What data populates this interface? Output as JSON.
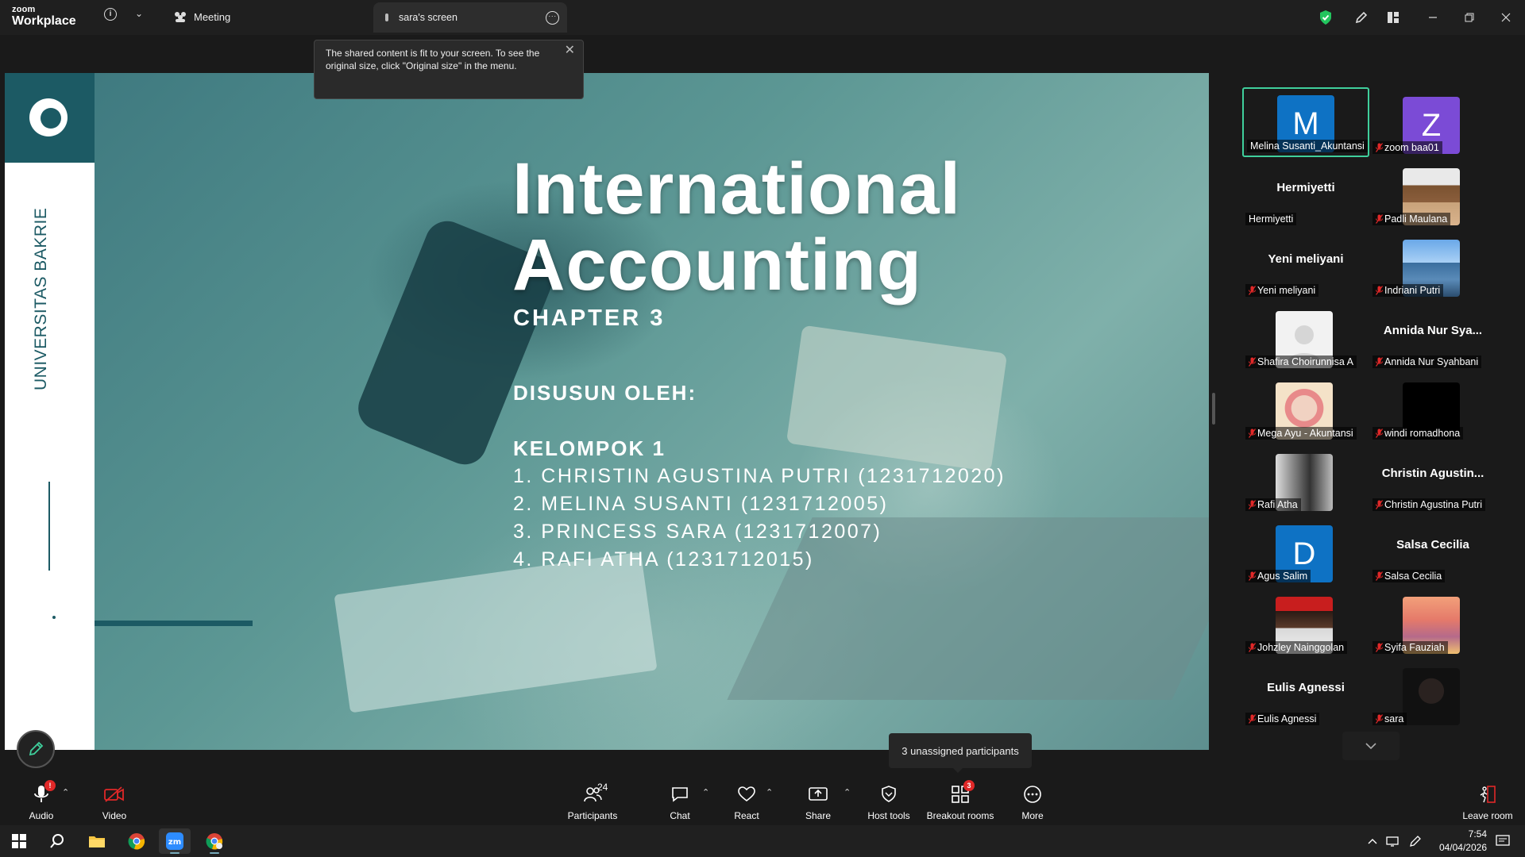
{
  "titlebar": {
    "logo_line1": "zoom",
    "logo_line2": "Workplace",
    "meeting_label": "Meeting",
    "tab_label": "sara's screen"
  },
  "tooltip": {
    "text": "The shared content is fit to your screen. To see the original size, click \"Original size\" in the menu."
  },
  "slide": {
    "university": "UNIVERSITAS BAKRIE",
    "title_line1": "International",
    "title_line2": "Accounting",
    "chapter": "CHAPTER 3",
    "disusun": "DISUSUN OLEH:",
    "kelompok": "KELOMPOK 1",
    "members": [
      "1. CHRISTIN AGUSTINA PUTRI (1231712020)",
      "2. MELINA SUSANTI (1231712005)",
      "3. PRINCESS SARA (1231712007)",
      "4. RAFI ATHA (1231712015)"
    ]
  },
  "gallery": {
    "tiles": [
      {
        "name": "Melina Susanti_Akuntansi",
        "initial": "M",
        "color": "#0e72c4",
        "type": "letter",
        "muted": false,
        "active": true
      },
      {
        "name": "zoom baa01",
        "initial": "Z",
        "color": "#7b4bd6",
        "type": "letter",
        "muted": true
      },
      {
        "name": "Hermiyetti",
        "big": "Hermiyetti",
        "type": "text",
        "muted": false
      },
      {
        "name": "Padli Maulana",
        "type": "photo",
        "muted": true
      },
      {
        "name": "Yeni meliyani",
        "big": "Yeni meliyani",
        "type": "text",
        "muted": true
      },
      {
        "name": "Indriani Putri",
        "type": "photo",
        "muted": true
      },
      {
        "name": "Shafira Choirunnisa A",
        "type": "default",
        "muted": true
      },
      {
        "name": "Annida Nur Syahbani",
        "big": "Annida Nur Sya...",
        "type": "text",
        "muted": true
      },
      {
        "name": "Mega Ayu - Akuntansi",
        "type": "photo",
        "muted": true
      },
      {
        "name": "windi romadhona",
        "type": "black",
        "muted": true
      },
      {
        "name": "Rafi Atha",
        "type": "photo",
        "muted": true
      },
      {
        "name": "Christin Agustina Putri",
        "big": "Christin  Agustin...",
        "type": "text",
        "muted": true
      },
      {
        "name": "Agus Salim",
        "initial": "D",
        "color": "#0e72c4",
        "type": "letter",
        "muted": true
      },
      {
        "name": "Salsa Cecilia",
        "big": "Salsa Cecilia",
        "type": "text",
        "muted": true
      },
      {
        "name": "Johzley Nainggolan",
        "type": "photo",
        "muted": true
      },
      {
        "name": "Syifa Fauziah",
        "type": "photo",
        "muted": true
      },
      {
        "name": "Eulis Agnessi",
        "big": "Eulis Agnessi",
        "type": "text",
        "muted": true
      },
      {
        "name": "sara",
        "type": "photo",
        "muted": true
      }
    ]
  },
  "unassigned_tooltip": "3 unassigned participants",
  "toolbar": {
    "audio": "Audio",
    "video": "Video",
    "participants": "Participants",
    "participants_count": "24",
    "chat": "Chat",
    "react": "React",
    "share": "Share",
    "host_tools": "Host tools",
    "breakout_rooms": "Breakout rooms",
    "breakout_badge": "3",
    "more": "More",
    "leave_room": "Leave room"
  },
  "taskbar": {
    "time": "7:54",
    "date": "04/04/2026"
  },
  "colors": {
    "accent_green": "#3fcf9c",
    "brand_blue": "#0e72c4",
    "slide_teal": "#1c5a64",
    "mute_red": "#e02828"
  }
}
